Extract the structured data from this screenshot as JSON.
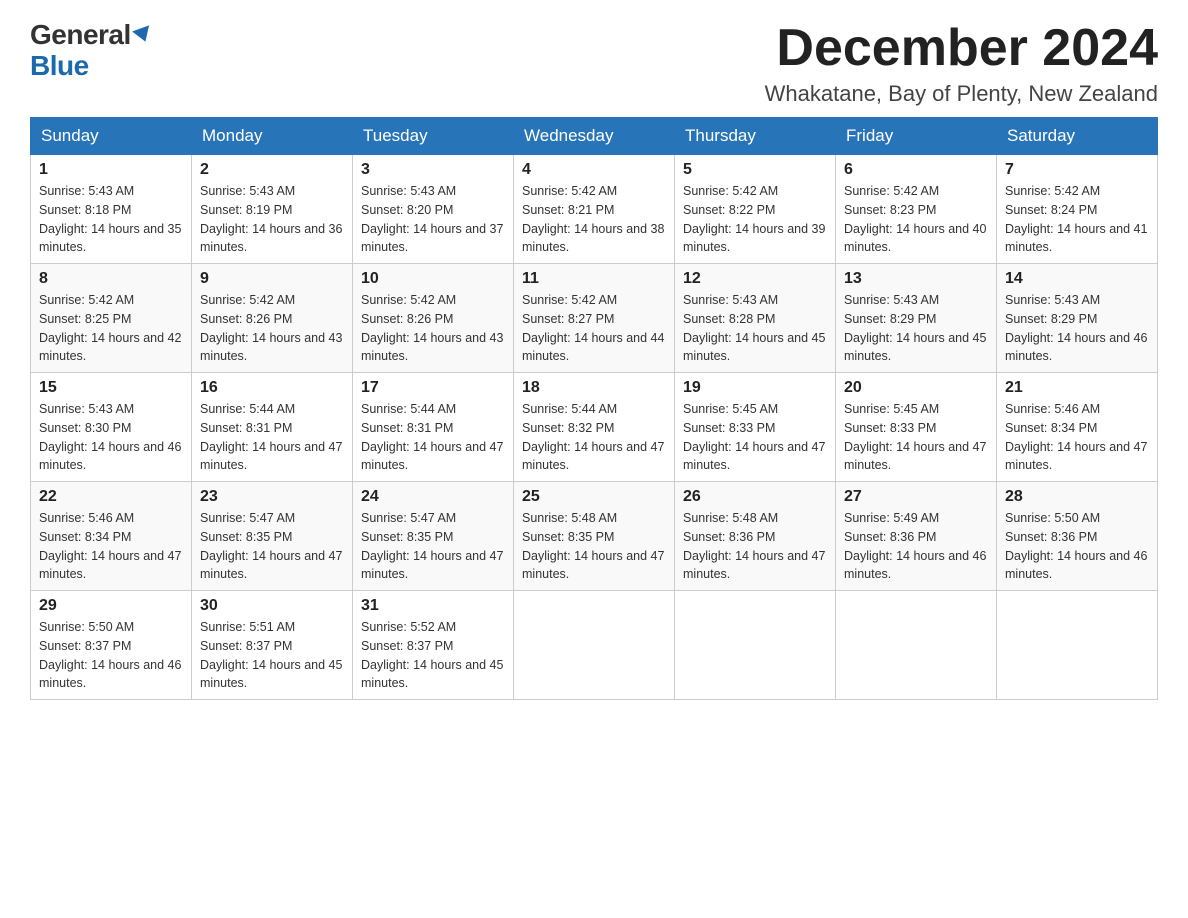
{
  "logo": {
    "general": "General",
    "blue": "Blue"
  },
  "header": {
    "month_year": "December 2024",
    "location": "Whakatane, Bay of Plenty, New Zealand"
  },
  "weekdays": [
    "Sunday",
    "Monday",
    "Tuesday",
    "Wednesday",
    "Thursday",
    "Friday",
    "Saturday"
  ],
  "weeks": [
    [
      {
        "day": "1",
        "sunrise": "Sunrise: 5:43 AM",
        "sunset": "Sunset: 8:18 PM",
        "daylight": "Daylight: 14 hours and 35 minutes."
      },
      {
        "day": "2",
        "sunrise": "Sunrise: 5:43 AM",
        "sunset": "Sunset: 8:19 PM",
        "daylight": "Daylight: 14 hours and 36 minutes."
      },
      {
        "day": "3",
        "sunrise": "Sunrise: 5:43 AM",
        "sunset": "Sunset: 8:20 PM",
        "daylight": "Daylight: 14 hours and 37 minutes."
      },
      {
        "day": "4",
        "sunrise": "Sunrise: 5:42 AM",
        "sunset": "Sunset: 8:21 PM",
        "daylight": "Daylight: 14 hours and 38 minutes."
      },
      {
        "day": "5",
        "sunrise": "Sunrise: 5:42 AM",
        "sunset": "Sunset: 8:22 PM",
        "daylight": "Daylight: 14 hours and 39 minutes."
      },
      {
        "day": "6",
        "sunrise": "Sunrise: 5:42 AM",
        "sunset": "Sunset: 8:23 PM",
        "daylight": "Daylight: 14 hours and 40 minutes."
      },
      {
        "day": "7",
        "sunrise": "Sunrise: 5:42 AM",
        "sunset": "Sunset: 8:24 PM",
        "daylight": "Daylight: 14 hours and 41 minutes."
      }
    ],
    [
      {
        "day": "8",
        "sunrise": "Sunrise: 5:42 AM",
        "sunset": "Sunset: 8:25 PM",
        "daylight": "Daylight: 14 hours and 42 minutes."
      },
      {
        "day": "9",
        "sunrise": "Sunrise: 5:42 AM",
        "sunset": "Sunset: 8:26 PM",
        "daylight": "Daylight: 14 hours and 43 minutes."
      },
      {
        "day": "10",
        "sunrise": "Sunrise: 5:42 AM",
        "sunset": "Sunset: 8:26 PM",
        "daylight": "Daylight: 14 hours and 43 minutes."
      },
      {
        "day": "11",
        "sunrise": "Sunrise: 5:42 AM",
        "sunset": "Sunset: 8:27 PM",
        "daylight": "Daylight: 14 hours and 44 minutes."
      },
      {
        "day": "12",
        "sunrise": "Sunrise: 5:43 AM",
        "sunset": "Sunset: 8:28 PM",
        "daylight": "Daylight: 14 hours and 45 minutes."
      },
      {
        "day": "13",
        "sunrise": "Sunrise: 5:43 AM",
        "sunset": "Sunset: 8:29 PM",
        "daylight": "Daylight: 14 hours and 45 minutes."
      },
      {
        "day": "14",
        "sunrise": "Sunrise: 5:43 AM",
        "sunset": "Sunset: 8:29 PM",
        "daylight": "Daylight: 14 hours and 46 minutes."
      }
    ],
    [
      {
        "day": "15",
        "sunrise": "Sunrise: 5:43 AM",
        "sunset": "Sunset: 8:30 PM",
        "daylight": "Daylight: 14 hours and 46 minutes."
      },
      {
        "day": "16",
        "sunrise": "Sunrise: 5:44 AM",
        "sunset": "Sunset: 8:31 PM",
        "daylight": "Daylight: 14 hours and 47 minutes."
      },
      {
        "day": "17",
        "sunrise": "Sunrise: 5:44 AM",
        "sunset": "Sunset: 8:31 PM",
        "daylight": "Daylight: 14 hours and 47 minutes."
      },
      {
        "day": "18",
        "sunrise": "Sunrise: 5:44 AM",
        "sunset": "Sunset: 8:32 PM",
        "daylight": "Daylight: 14 hours and 47 minutes."
      },
      {
        "day": "19",
        "sunrise": "Sunrise: 5:45 AM",
        "sunset": "Sunset: 8:33 PM",
        "daylight": "Daylight: 14 hours and 47 minutes."
      },
      {
        "day": "20",
        "sunrise": "Sunrise: 5:45 AM",
        "sunset": "Sunset: 8:33 PM",
        "daylight": "Daylight: 14 hours and 47 minutes."
      },
      {
        "day": "21",
        "sunrise": "Sunrise: 5:46 AM",
        "sunset": "Sunset: 8:34 PM",
        "daylight": "Daylight: 14 hours and 47 minutes."
      }
    ],
    [
      {
        "day": "22",
        "sunrise": "Sunrise: 5:46 AM",
        "sunset": "Sunset: 8:34 PM",
        "daylight": "Daylight: 14 hours and 47 minutes."
      },
      {
        "day": "23",
        "sunrise": "Sunrise: 5:47 AM",
        "sunset": "Sunset: 8:35 PM",
        "daylight": "Daylight: 14 hours and 47 minutes."
      },
      {
        "day": "24",
        "sunrise": "Sunrise: 5:47 AM",
        "sunset": "Sunset: 8:35 PM",
        "daylight": "Daylight: 14 hours and 47 minutes."
      },
      {
        "day": "25",
        "sunrise": "Sunrise: 5:48 AM",
        "sunset": "Sunset: 8:35 PM",
        "daylight": "Daylight: 14 hours and 47 minutes."
      },
      {
        "day": "26",
        "sunrise": "Sunrise: 5:48 AM",
        "sunset": "Sunset: 8:36 PM",
        "daylight": "Daylight: 14 hours and 47 minutes."
      },
      {
        "day": "27",
        "sunrise": "Sunrise: 5:49 AM",
        "sunset": "Sunset: 8:36 PM",
        "daylight": "Daylight: 14 hours and 46 minutes."
      },
      {
        "day": "28",
        "sunrise": "Sunrise: 5:50 AM",
        "sunset": "Sunset: 8:36 PM",
        "daylight": "Daylight: 14 hours and 46 minutes."
      }
    ],
    [
      {
        "day": "29",
        "sunrise": "Sunrise: 5:50 AM",
        "sunset": "Sunset: 8:37 PM",
        "daylight": "Daylight: 14 hours and 46 minutes."
      },
      {
        "day": "30",
        "sunrise": "Sunrise: 5:51 AM",
        "sunset": "Sunset: 8:37 PM",
        "daylight": "Daylight: 14 hours and 45 minutes."
      },
      {
        "day": "31",
        "sunrise": "Sunrise: 5:52 AM",
        "sunset": "Sunset: 8:37 PM",
        "daylight": "Daylight: 14 hours and 45 minutes."
      },
      null,
      null,
      null,
      null
    ]
  ]
}
